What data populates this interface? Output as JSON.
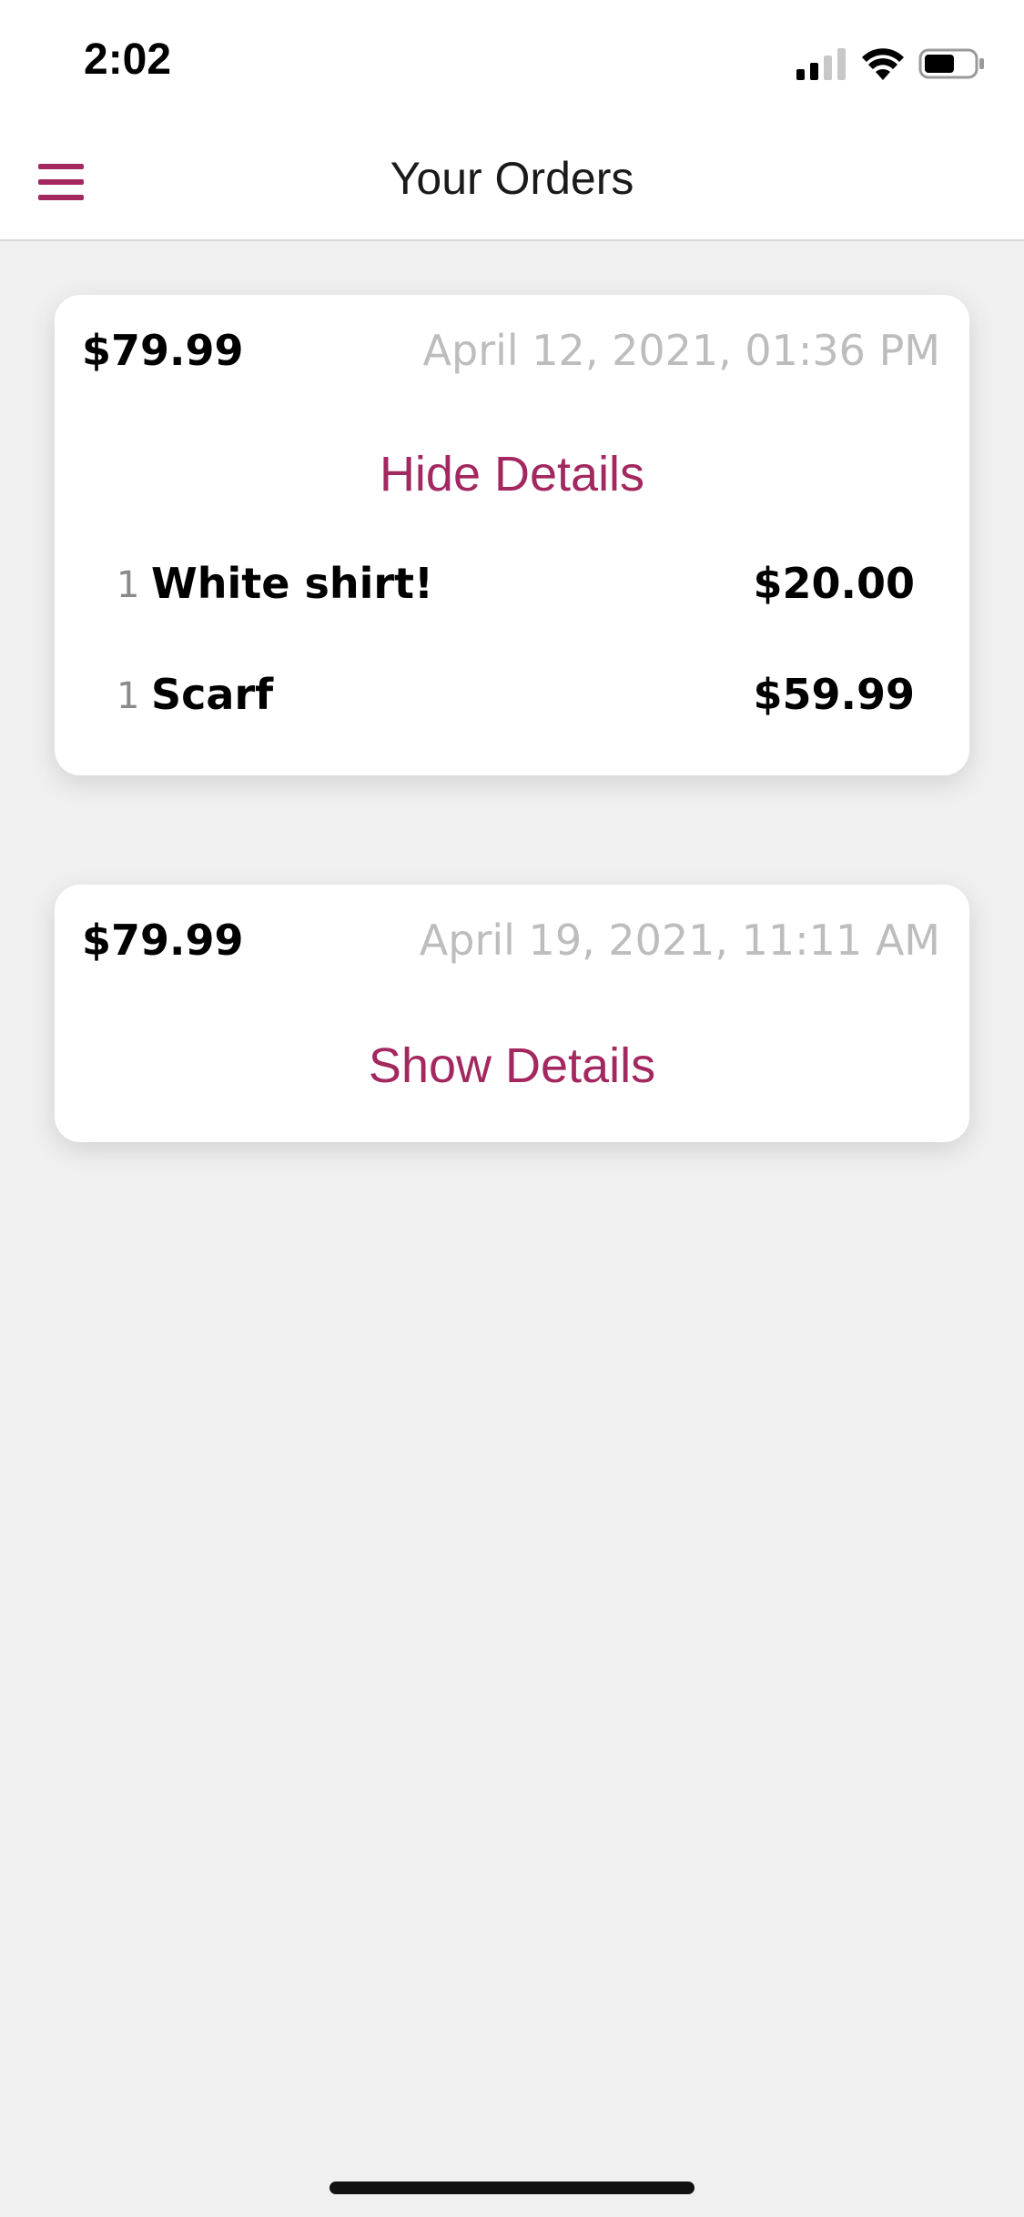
{
  "status_bar": {
    "time": "2:02",
    "icons": [
      "signal-icon",
      "wifi-icon",
      "battery-icon"
    ]
  },
  "header": {
    "title": "Your Orders",
    "menu_icon": "hamburger-menu-icon"
  },
  "colors": {
    "accent": "#a3285f",
    "background": "#f0f0f0",
    "card": "#ffffff",
    "date_text": "#bdbdbd"
  },
  "orders": [
    {
      "total": "$79.99",
      "date": "April 12, 2021, 01:36 PM",
      "toggle_label": "Hide Details",
      "expanded": true,
      "items": [
        {
          "qty": "1",
          "name": "White shirt!",
          "price": "$20.00"
        },
        {
          "qty": "1",
          "name": "Scarf",
          "price": "$59.99"
        }
      ]
    },
    {
      "total": "$79.99",
      "date": "April 19, 2021, 11:11 AM",
      "toggle_label": "Show Details",
      "expanded": false,
      "items": []
    }
  ]
}
